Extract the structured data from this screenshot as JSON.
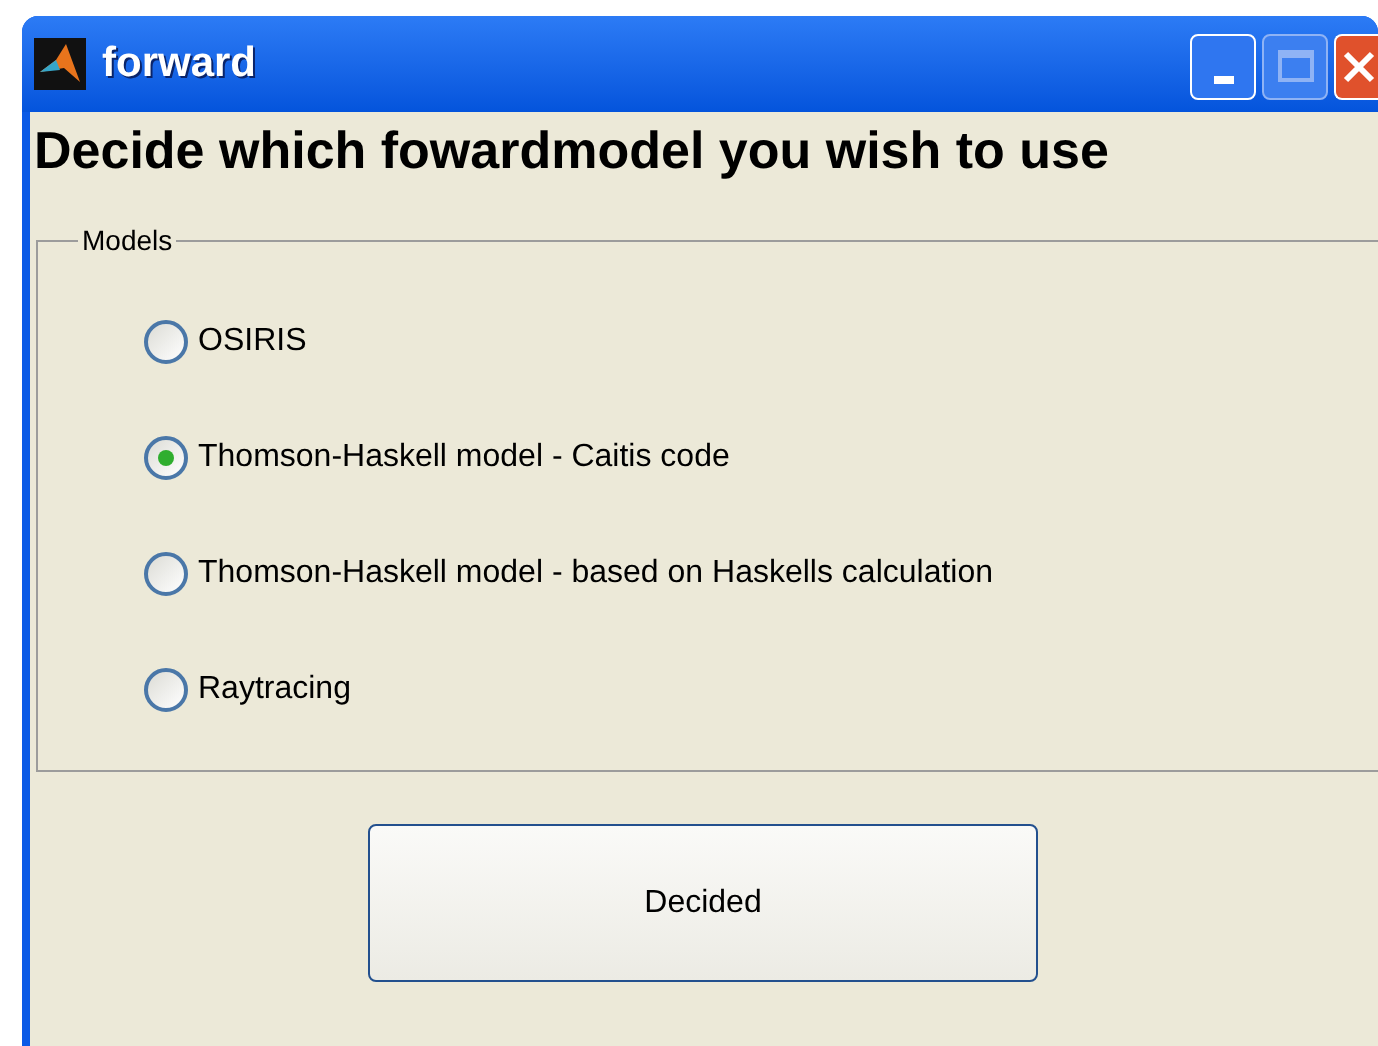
{
  "window": {
    "title": "forward"
  },
  "heading": "Decide which fowardmodel you wish to use",
  "models": {
    "label": "Models",
    "options": [
      {
        "label": "OSIRIS",
        "selected": false
      },
      {
        "label": "Thomson-Haskell model - Caitis code",
        "selected": true
      },
      {
        "label": "Thomson-Haskell model - based on Haskells calculation",
        "selected": false
      },
      {
        "label": "Raytracing",
        "selected": false
      }
    ]
  },
  "button": {
    "label": "Decided"
  }
}
